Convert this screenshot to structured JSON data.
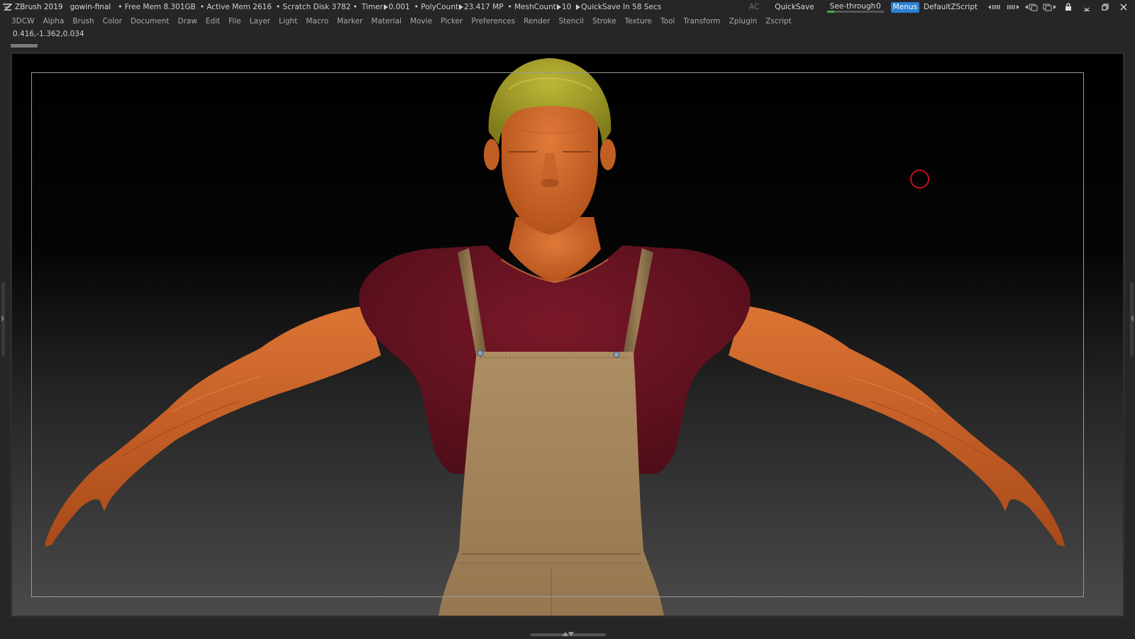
{
  "titlebar": {
    "app_name": "ZBrush 2019",
    "doc_name": "gowin-final",
    "free_mem": "• Free Mem 8.301GB",
    "active_mem": "• Active Mem 2616",
    "scratch_disk": "• Scratch Disk 3782 •",
    "timer_label": "Timer",
    "timer_value": "0.001",
    "polycount_label": "• PolyCount",
    "polycount_value": "23.417 MP",
    "meshcount_label": "• MeshCount",
    "meshcount_value": "10",
    "quicksave_status": "QuickSave In 58 Secs",
    "ac_label": "AC",
    "quicksave_label": "QuickSave",
    "seethrough_label": "See-through",
    "seethrough_value": "0",
    "seethrough_level": 0.12,
    "menus_label": "Menus",
    "script_name": "DefaultZScript",
    "icons": [
      "tray-collapse-icon",
      "tray-expand-icon",
      "ui-layout-icon",
      "ui-swap-icon",
      "lock-icon",
      "minimize-icon",
      "restore-icon",
      "close-icon"
    ]
  },
  "menubar": {
    "items": [
      "3DCW",
      "Alpha",
      "Brush",
      "Color",
      "Document",
      "Draw",
      "Edit",
      "File",
      "Layer",
      "Light",
      "Macro",
      "Marker",
      "Material",
      "Movie",
      "Picker",
      "Preferences",
      "Render",
      "Stencil",
      "Stroke",
      "Texture",
      "Tool",
      "Transform",
      "Zplugin",
      "Zscript"
    ]
  },
  "canvas": {
    "coords": "0.416,-1.362,0.034"
  },
  "colors": {
    "skin": "#d26a2c",
    "shirt": "#6b1422",
    "hair": "#a9a62a",
    "overalls": "#a5865c",
    "accent_blue": "#2a7fd6",
    "brush_cursor": "#c1121c"
  }
}
